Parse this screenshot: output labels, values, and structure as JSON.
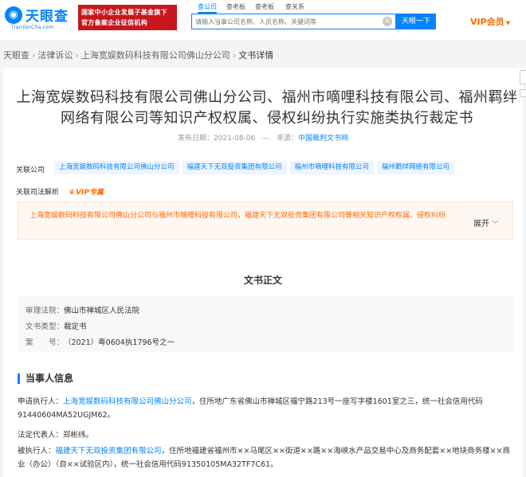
{
  "header": {
    "logo_text": "天眼查",
    "logo_sub": "TianYanCha.com",
    "banner_line1": "国家中小企业发展子基金旗下",
    "banner_line2": "官方备案企业征信机构",
    "search_tabs": [
      "查公司",
      "查老板",
      "查老板",
      "查关系"
    ],
    "search_placeholder": "请输入当事公司名称、人员名称、关键词等",
    "search_button": "天眼一下",
    "vip_label": "VIP会员"
  },
  "breadcrumb": {
    "home": "天眼查",
    "category": "法律诉讼",
    "company": "上海宽娱数码科技有限公司佛山分公司",
    "current": "文书详情",
    "separator": "›"
  },
  "document": {
    "title": "上海宽娱数码科技有限公司佛山分公司、福州市嘀哩科技有限公司、福州羁绊网络有限公司等知识产权权属、侵权纠纷执行实施类执行裁定书",
    "date_label": "发布日期：2021-08-06",
    "source_label": "来源：",
    "source_value": "中国裁判文书网",
    "related_label": "关联公司",
    "related_companies": [
      "上海宽娱数码科技有限公司佛山分公司",
      "福建天下无双投资集团有限公司",
      "福州市嘀哩科技有限公司",
      "福州羁绊网络有限公司"
    ],
    "analysis_label": "关联司法解析",
    "vip_tag": "VIP专属",
    "analysis_text": "上海宽娱数码科技有限公司佛山分公司与福州市嘀哩科技有限公司，福建天下无双投资集团有限公司等相关知识产权权属、侵权纠纷",
    "expand_label": "展开"
  },
  "body": {
    "section_title": "文书正文",
    "info": [
      {
        "key": "审理法院：",
        "value": "佛山市禅城区人民法院"
      },
      {
        "key": "文书类型：",
        "value": "裁定书"
      },
      {
        "key": "案　　号：",
        "value": "（2021）粤0604执1796号之一"
      }
    ],
    "parties_title": "当事人信息",
    "applicant_prefix": "申请执行人：",
    "applicant_name": "上海宽娱数码科技有限公司佛山分公司",
    "applicant_rest": "，住所地广东省佛山市禅城区福宁路213号一座写字楼1601室之三，统一社会信用代码91440604MA52UGJM62。",
    "rep_text": "法定代表人：郑彬纬。",
    "respondent_prefix": "被执行人：",
    "respondent_name": "福建天下无双投资集团有限公司",
    "respondent_rest": "，住所地福建省福州市××马尾区××街道××路××海峡水产品交易中心及商务配套××地块商务楼××商业（办公）（自××试验区内），统一社会信用代码91350105MA32TF7C61。"
  },
  "colors": {
    "brand_blue": "#0084ff",
    "vip_orange": "#ff6a00",
    "banner_red": "#c8161d"
  }
}
